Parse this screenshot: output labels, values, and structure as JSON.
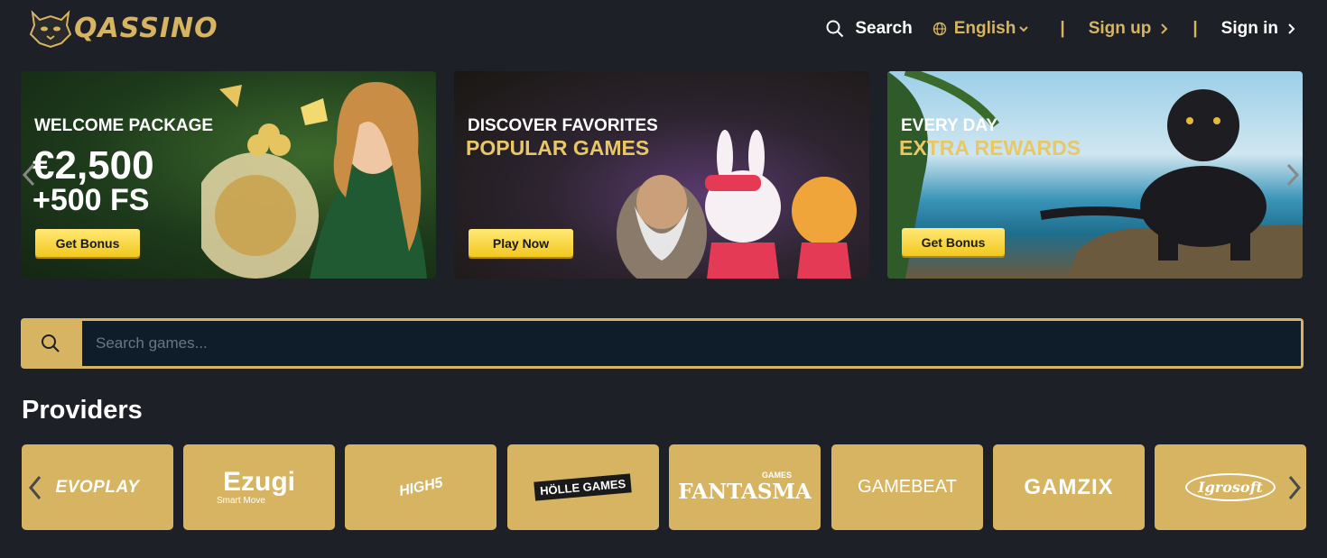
{
  "header": {
    "logo_text": "QASSINO",
    "search_label": "Search",
    "language": "English",
    "signup": "Sign up",
    "signin": "Sign in",
    "separator": "|"
  },
  "banners": [
    {
      "line1": "WELCOME PACKAGE",
      "big1": "€2,500",
      "big2": "+500 FS",
      "button": "Get Bonus"
    },
    {
      "line1": "DISCOVER FAVORITES",
      "line2": "POPULAR GAMES",
      "button": "Play Now"
    },
    {
      "line1": "EVERY DAY",
      "line2": "EXTRA REWARDS",
      "button": "Get Bonus"
    }
  ],
  "search": {
    "placeholder": "Search games..."
  },
  "providers": {
    "title": "Providers",
    "items": [
      "EVOPLAY",
      "Ezugi",
      "HIGH5",
      "HÖLLE GAMES",
      "FANTASMA",
      "GAMEBEAT",
      "GAMZIX",
      "Igrosoft"
    ],
    "ezugi_sub": "Smart Move",
    "fantasma_sub": "GAMES"
  },
  "colors": {
    "accent": "#d6b462",
    "background": "#1e2027",
    "search_field": "#0f1c2a",
    "button": "#f2c920"
  }
}
